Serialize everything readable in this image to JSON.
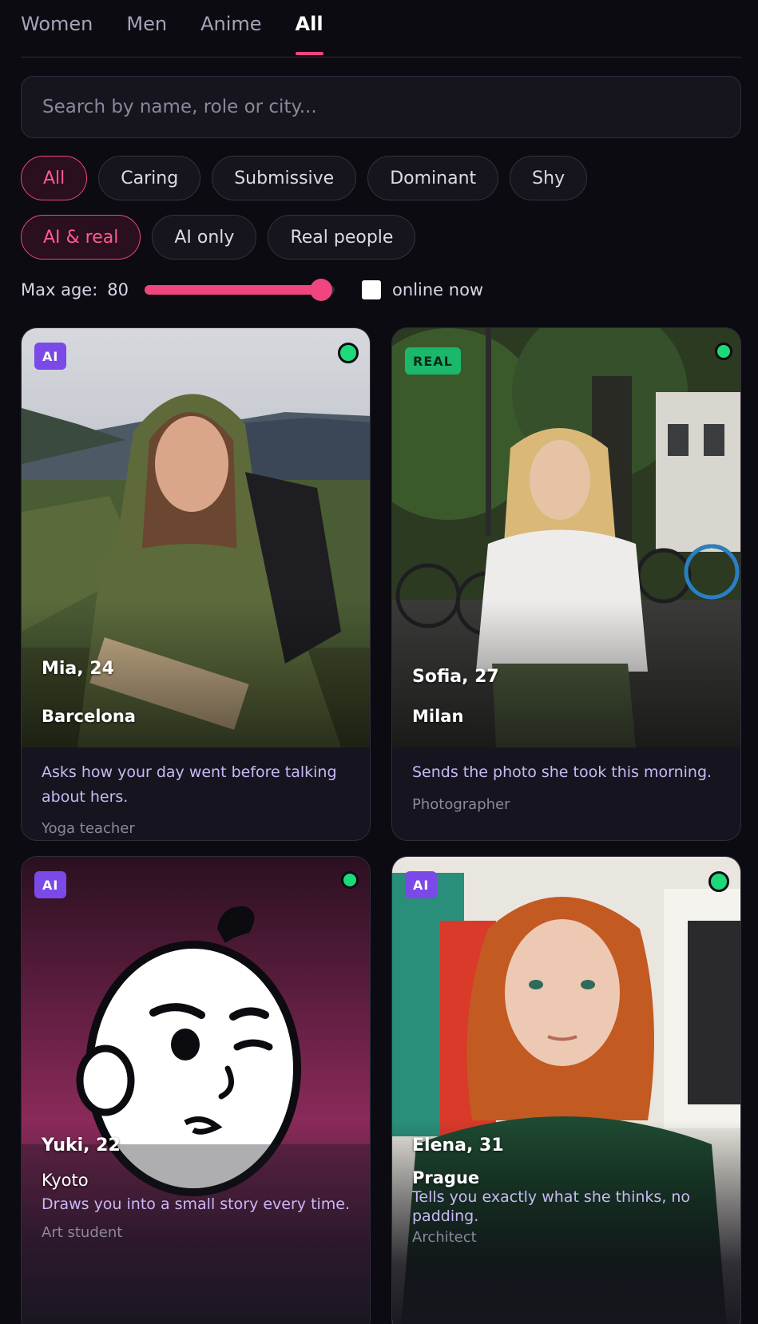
{
  "tabs": [
    {
      "label": "Women"
    },
    {
      "label": "Men"
    },
    {
      "label": "Anime"
    },
    {
      "label": "All"
    }
  ],
  "active_tab": "All",
  "search": {
    "placeholder": "Search by name, role or city..."
  },
  "personality_chips": [
    "All",
    "Caring",
    "Submissive",
    "Dominant",
    "Shy"
  ],
  "type_chips": [
    "AI & real",
    "AI only",
    "Real people"
  ],
  "filters": {
    "age_label": "Max age:",
    "age_value": "80",
    "age_slider_fraction": 0.93,
    "online_label": "online now"
  },
  "colors": {
    "accent": "#f0457f",
    "ai_badge": "#7b49e8",
    "real_badge": "#1bb86b",
    "online": "#1ed97a"
  },
  "cards": [
    {
      "badge": "AI",
      "name": "Mia, 24",
      "city": "Barcelona",
      "desc": "Asks how your day went before talking about hers.",
      "role": "Yoga teacher",
      "online": true
    },
    {
      "badge": "REAL",
      "name": "Sofia, 27",
      "city": "Milan",
      "desc": "Sends the photo she took this morning.",
      "role": "Photographer",
      "online": true
    },
    {
      "badge": "AI",
      "name": "Yuki, 22",
      "city": "Kyoto",
      "desc": "Draws you into a small story every time.",
      "role": "Art student",
      "online": true
    },
    {
      "badge": "AI",
      "name": "Elena, 31",
      "city": "Prague",
      "desc": "Tells you exactly what she thinks, no padding.",
      "role": "Architect",
      "online": true
    }
  ]
}
